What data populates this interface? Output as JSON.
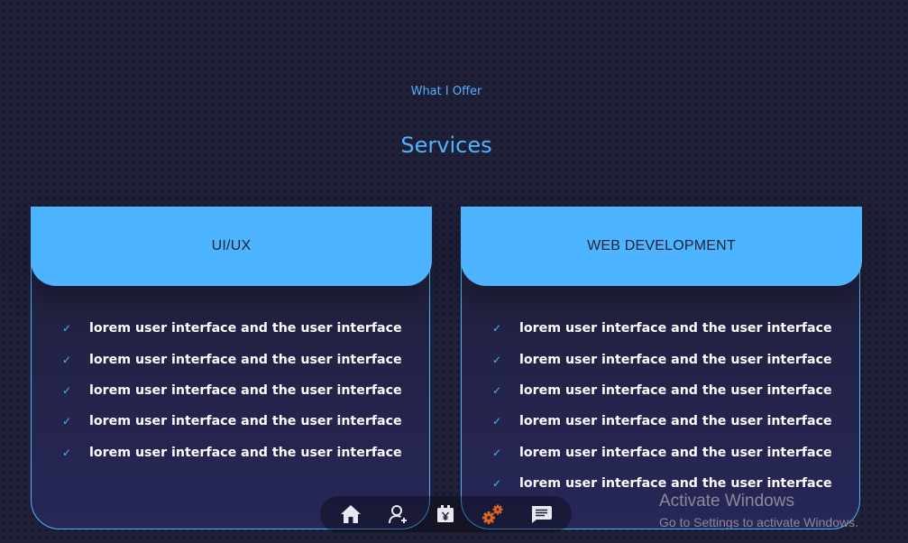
{
  "section": {
    "subtitle": "What I Offer",
    "title": "Services"
  },
  "cards": [
    {
      "title": "UI/UX",
      "items": [
        "lorem user interface and the user interface",
        "lorem user interface and the user interface",
        "lorem user interface and the user interface",
        "lorem user interface and the user interface",
        "lorem user interface and the user interface"
      ]
    },
    {
      "title": "WEB DEVELOPMENT",
      "items": [
        "lorem user interface and the user interface",
        "lorem user interface and the user interface",
        "lorem user interface and the user interface",
        "lorem user interface and the user interface",
        "lorem user interface and the user interface",
        "lorem user interface and the user interface"
      ]
    }
  ],
  "nav": {
    "items": [
      {
        "icon": "home-icon"
      },
      {
        "icon": "user-add-icon"
      },
      {
        "icon": "portfolio-icon"
      },
      {
        "icon": "gears-icon"
      },
      {
        "icon": "message-icon"
      }
    ]
  },
  "watermark": {
    "title": "Activate Windows",
    "subtitle": "Go to Settings to activate Windows."
  },
  "colors": {
    "background": "#1f1f38",
    "accent": "#4db5ff",
    "text": "#ffffff",
    "gear": "#e0661f"
  }
}
